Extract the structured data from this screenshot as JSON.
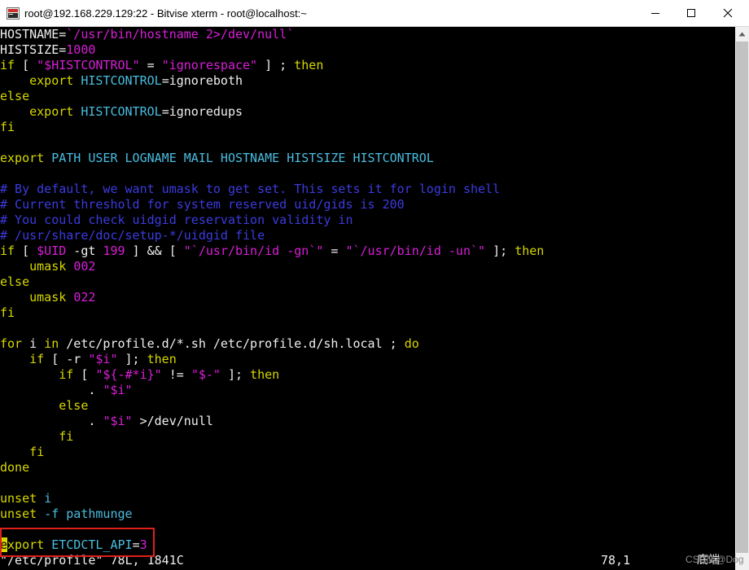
{
  "window": {
    "title": "root@192.168.229.129:22 - Bitvise xterm - root@localhost:~",
    "app_icon": "bitvise-terminal-icon",
    "controls": [
      "minimize-icon",
      "maximize-icon",
      "close-icon"
    ]
  },
  "colors": {
    "default_text": "#f0f0f0",
    "string": "#d71fd7",
    "keyword": "#d7d700",
    "variable": "#49bcdf",
    "comment": "#3b3bdf",
    "highlight_box": "#e0201a",
    "background": "#000000"
  },
  "terminal": {
    "lines": [
      [
        {
          "t": "HOSTNAME=",
          "c": "default"
        },
        {
          "t": "`/usr/bin/hostname 2>/dev/null`",
          "c": "string"
        }
      ],
      [
        {
          "t": "HISTSIZE=",
          "c": "default"
        },
        {
          "t": "1000",
          "c": "number"
        }
      ],
      [
        {
          "t": "if",
          "c": "keyword"
        },
        {
          "t": " [ ",
          "c": "default"
        },
        {
          "t": "\"",
          "c": "string"
        },
        {
          "t": "$HISTCONTROL",
          "c": "string"
        },
        {
          "t": "\"",
          "c": "string"
        },
        {
          "t": " = ",
          "c": "default"
        },
        {
          "t": "\"ignorespace\"",
          "c": "string"
        },
        {
          "t": " ] ; ",
          "c": "default"
        },
        {
          "t": "then",
          "c": "keyword"
        }
      ],
      [
        {
          "t": "    export ",
          "c": "keyword"
        },
        {
          "t": "HISTCONTROL",
          "c": "variable"
        },
        {
          "t": "=ignoreboth",
          "c": "default"
        }
      ],
      [
        {
          "t": "else",
          "c": "keyword"
        }
      ],
      [
        {
          "t": "    export ",
          "c": "keyword"
        },
        {
          "t": "HISTCONTROL",
          "c": "variable"
        },
        {
          "t": "=ignoredups",
          "c": "default"
        }
      ],
      [
        {
          "t": "fi",
          "c": "keyword"
        }
      ],
      [
        {
          "t": "",
          "c": "default"
        }
      ],
      [
        {
          "t": "export ",
          "c": "keyword"
        },
        {
          "t": "PATH USER LOGNAME MAIL HOSTNAME HISTSIZE HISTCONTROL",
          "c": "variable"
        }
      ],
      [
        {
          "t": "",
          "c": "default"
        }
      ],
      [
        {
          "t": "# By default, we want umask to get set. This sets it for login shell",
          "c": "comment"
        }
      ],
      [
        {
          "t": "# Current threshold for system reserved uid/gids is 200",
          "c": "comment"
        }
      ],
      [
        {
          "t": "# You could check uidgid reservation validity in",
          "c": "comment"
        }
      ],
      [
        {
          "t": "# /usr/share/doc/setup-*/uidgid file",
          "c": "comment"
        }
      ],
      [
        {
          "t": "if",
          "c": "keyword"
        },
        {
          "t": " [ ",
          "c": "default"
        },
        {
          "t": "$UID",
          "c": "string"
        },
        {
          "t": " -gt ",
          "c": "default"
        },
        {
          "t": "199",
          "c": "number"
        },
        {
          "t": " ] && [ ",
          "c": "default"
        },
        {
          "t": "\"",
          "c": "string"
        },
        {
          "t": "`/usr/bin/id -gn`",
          "c": "string"
        },
        {
          "t": "\"",
          "c": "string"
        },
        {
          "t": " = ",
          "c": "default"
        },
        {
          "t": "\"",
          "c": "string"
        },
        {
          "t": "`/usr/bin/id -un`",
          "c": "string"
        },
        {
          "t": "\"",
          "c": "string"
        },
        {
          "t": " ]; ",
          "c": "default"
        },
        {
          "t": "then",
          "c": "keyword"
        }
      ],
      [
        {
          "t": "    umask ",
          "c": "keyword"
        },
        {
          "t": "002",
          "c": "number"
        }
      ],
      [
        {
          "t": "else",
          "c": "keyword"
        }
      ],
      [
        {
          "t": "    umask ",
          "c": "keyword"
        },
        {
          "t": "022",
          "c": "number"
        }
      ],
      [
        {
          "t": "fi",
          "c": "keyword"
        }
      ],
      [
        {
          "t": "",
          "c": "default"
        }
      ],
      [
        {
          "t": "for",
          "c": "keyword"
        },
        {
          "t": " i ",
          "c": "default"
        },
        {
          "t": "in",
          "c": "keyword"
        },
        {
          "t": " /etc/profile.d/*.sh /etc/profile.d/sh.local ; ",
          "c": "default"
        },
        {
          "t": "do",
          "c": "keyword"
        }
      ],
      [
        {
          "t": "    if",
          "c": "keyword"
        },
        {
          "t": " [ -r ",
          "c": "default"
        },
        {
          "t": "\"",
          "c": "string"
        },
        {
          "t": "$i",
          "c": "string"
        },
        {
          "t": "\"",
          "c": "string"
        },
        {
          "t": " ]; ",
          "c": "default"
        },
        {
          "t": "then",
          "c": "keyword"
        }
      ],
      [
        {
          "t": "        if",
          "c": "keyword"
        },
        {
          "t": " [ ",
          "c": "default"
        },
        {
          "t": "\"",
          "c": "string"
        },
        {
          "t": "${-#*i}",
          "c": "string"
        },
        {
          "t": "\"",
          "c": "string"
        },
        {
          "t": " != ",
          "c": "default"
        },
        {
          "t": "\"",
          "c": "string"
        },
        {
          "t": "$-",
          "c": "string"
        },
        {
          "t": "\"",
          "c": "string"
        },
        {
          "t": " ]; ",
          "c": "default"
        },
        {
          "t": "then",
          "c": "keyword"
        }
      ],
      [
        {
          "t": "            . ",
          "c": "default"
        },
        {
          "t": "\"",
          "c": "string"
        },
        {
          "t": "$i",
          "c": "string"
        },
        {
          "t": "\"",
          "c": "string"
        }
      ],
      [
        {
          "t": "        else",
          "c": "keyword"
        }
      ],
      [
        {
          "t": "            . ",
          "c": "default"
        },
        {
          "t": "\"",
          "c": "string"
        },
        {
          "t": "$i",
          "c": "string"
        },
        {
          "t": "\"",
          "c": "string"
        },
        {
          "t": " >/dev/null",
          "c": "default"
        }
      ],
      [
        {
          "t": "        fi",
          "c": "keyword"
        }
      ],
      [
        {
          "t": "    fi",
          "c": "keyword"
        }
      ],
      [
        {
          "t": "done",
          "c": "keyword"
        }
      ],
      [
        {
          "t": "",
          "c": "default"
        }
      ],
      [
        {
          "t": "unset ",
          "c": "keyword"
        },
        {
          "t": "i",
          "c": "variable"
        }
      ],
      [
        {
          "t": "unset ",
          "c": "keyword"
        },
        {
          "t": "-f pathmunge",
          "c": "variable"
        }
      ],
      [
        {
          "t": "",
          "c": "default"
        }
      ],
      [
        {
          "t": "e",
          "c": "cursor"
        },
        {
          "t": "xport ",
          "c": "keyword"
        },
        {
          "t": "ETCDCTL_API",
          "c": "variable"
        },
        {
          "t": "=",
          "c": "default"
        },
        {
          "t": "3",
          "c": "number"
        }
      ]
    ],
    "status_line": {
      "file_info": "\"/etc/profile\" 78L, 1841C",
      "position": "78,1",
      "scroll": "底端"
    }
  },
  "watermark": "CSDN @Dog"
}
